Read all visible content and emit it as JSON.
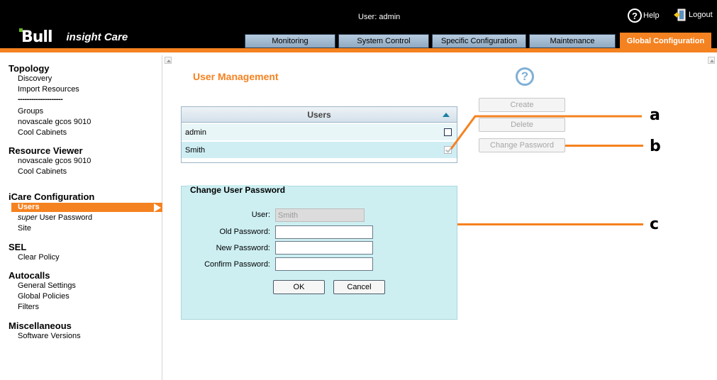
{
  "header": {
    "logo_text": "Bull",
    "product": "insight Care",
    "user_label": "User: admin",
    "help_label": "Help",
    "logout_label": "Logout",
    "help_icon_glyph": "?",
    "icons": [
      "help-icon",
      "logout-door-icon"
    ]
  },
  "tabs": [
    {
      "label": "Monitoring"
    },
    {
      "label": "System Control"
    },
    {
      "label": "Specific Configuration"
    },
    {
      "label": "Maintenance"
    },
    {
      "label": "Global Configuration",
      "active": true
    }
  ],
  "sidebar": {
    "topology": {
      "title": "Topology",
      "items": [
        "Discovery",
        "Import Resources",
        "--------------------",
        "Groups",
        "novascale gcos 9010",
        "Cool Cabinets"
      ]
    },
    "resource_viewer": {
      "title": "Resource Viewer",
      "items": [
        "novascale gcos 9010",
        "Cool Cabinets"
      ]
    },
    "icare_configuration": {
      "title": "iCare Configuration",
      "selected": "Users",
      "super_prefix": "super",
      "super_rest": " User Password",
      "site": "Site"
    },
    "sel": {
      "title": "SEL",
      "items": [
        "Clear Policy"
      ]
    },
    "autocalls": {
      "title": "Autocalls",
      "items": [
        "General Settings",
        "Global Policies",
        "Filters"
      ]
    },
    "miscellaneous": {
      "title": "Miscellaneous",
      "items": [
        "Software Versions"
      ]
    }
  },
  "main": {
    "title": "User Management",
    "help_glyph": "?",
    "users_table": {
      "header": "Users",
      "rows": [
        {
          "name": "admin",
          "checked": false
        },
        {
          "name": "Smith",
          "checked": true
        }
      ]
    },
    "actions": {
      "create": "Create",
      "delete": "Delete",
      "change_password": "Change Password"
    },
    "callouts": {
      "a": "a",
      "b": "b",
      "c": "c"
    },
    "change_password": {
      "legend": "Change User Password",
      "user_label": "User:",
      "user_value": "Smith",
      "old_label": "Old Password:",
      "new_label": "New Password:",
      "confirm_label": "Confirm Password:",
      "ok": "OK",
      "cancel": "Cancel"
    }
  },
  "colors": {
    "accent": "#f58220",
    "tab": "#a6bdd3",
    "panel": "#cdeff2",
    "header_bg": "#000000"
  }
}
